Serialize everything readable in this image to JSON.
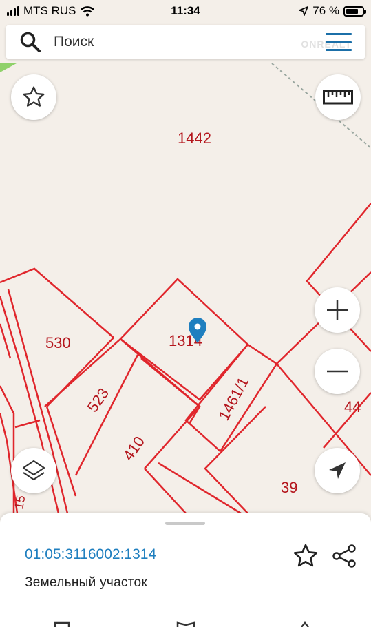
{
  "status_bar": {
    "carrier": "MTS RUS",
    "time": "11:34",
    "battery_percent": "76 %",
    "battery_level": 0.76
  },
  "search": {
    "placeholder": "Поиск",
    "watermark": "ONREALT"
  },
  "map": {
    "parcel_labels": [
      {
        "text": "1442"
      },
      {
        "text": "530"
      },
      {
        "text": "1314"
      },
      {
        "text": "523"
      },
      {
        "text": "410"
      },
      {
        "text": "1461/1"
      },
      {
        "text": "44"
      },
      {
        "text": "39"
      },
      {
        "text": "15"
      }
    ],
    "boundary_color": "#e0262c",
    "marker_color": "#1f7fbf"
  },
  "controls": {
    "favorite_icon": "star-outline-icon",
    "ruler_icon": "ruler-icon",
    "zoom_in_icon": "plus-icon",
    "zoom_out_icon": "minus-icon",
    "layers_icon": "layers-icon",
    "locate_icon": "navigation-arrow-icon"
  },
  "info_sheet": {
    "cadastral_number": "01:05:3116002:1314",
    "object_type": "Земельный участок",
    "link_color": "#1f7fbf"
  }
}
